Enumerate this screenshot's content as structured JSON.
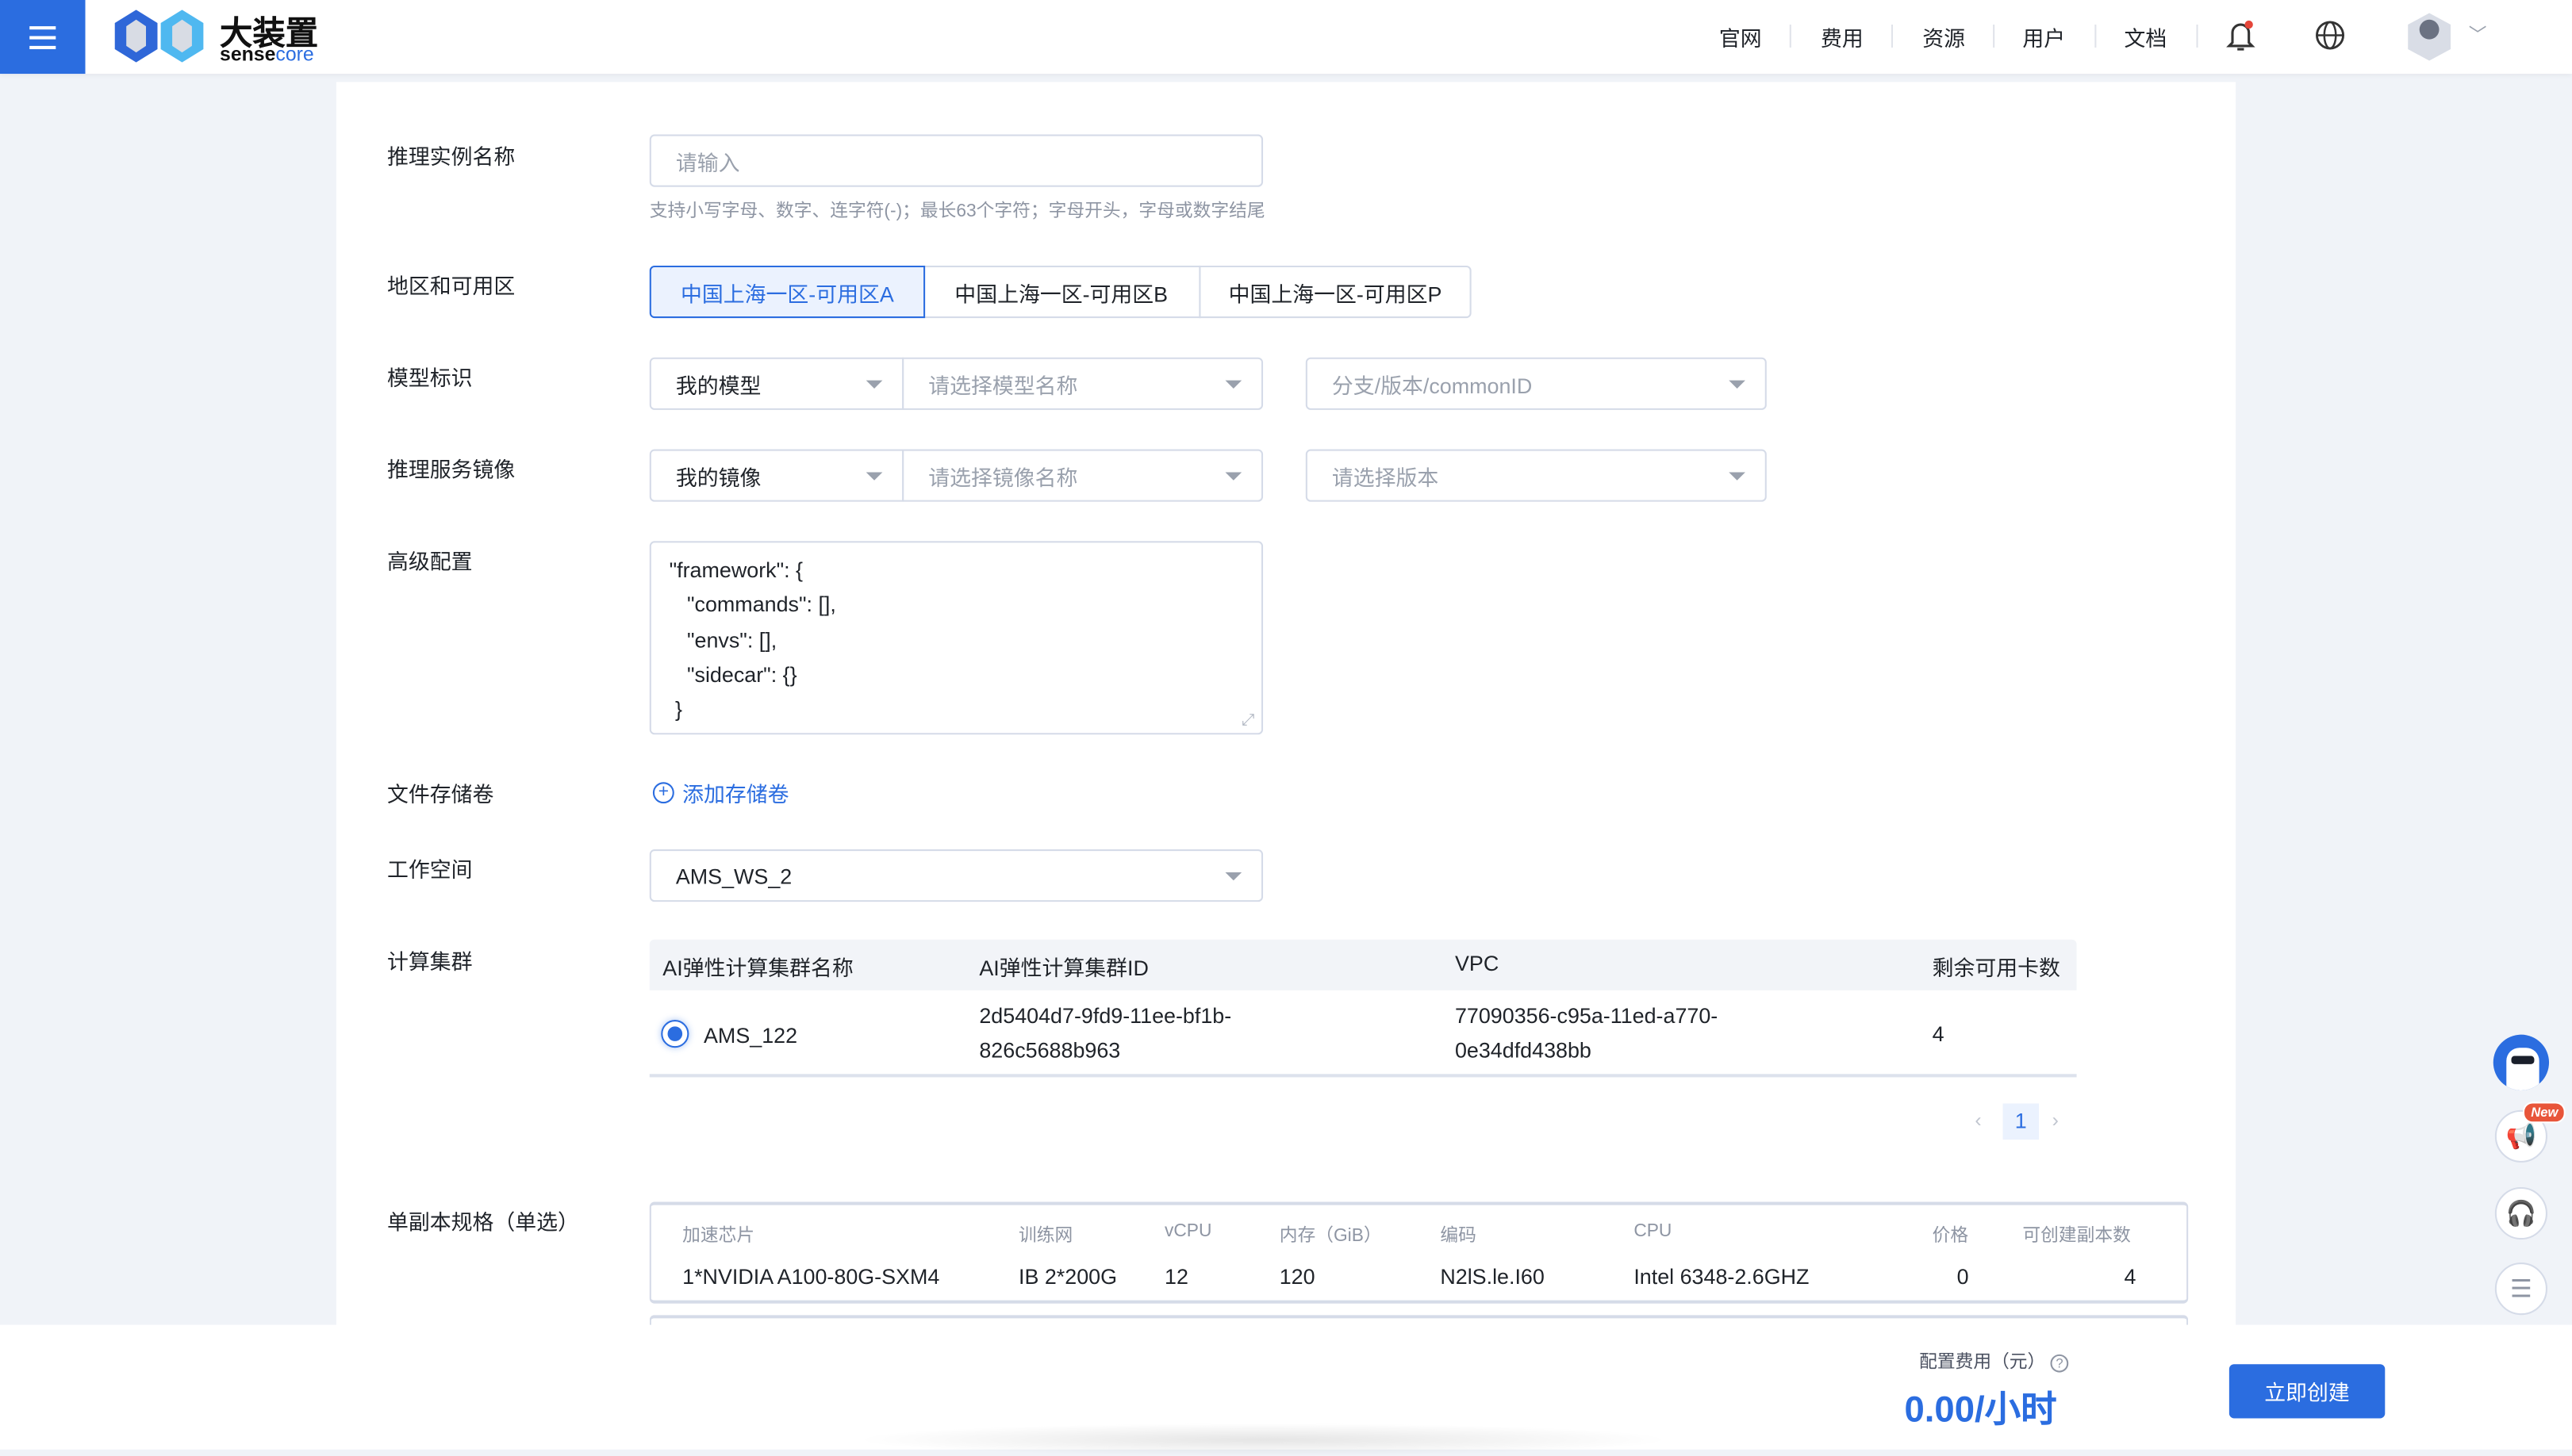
{
  "header": {
    "logo_cn": "大装置",
    "logo_en_1": "sense",
    "logo_en_2": "core",
    "nav": [
      "官网",
      "费用",
      "资源",
      "用户",
      "文档"
    ]
  },
  "form": {
    "name": {
      "label": "推理实例名称",
      "placeholder": "请输入",
      "hint": "支持小写字母、数字、连字符(-)；最长63个字符；字母开头，字母或数字结尾"
    },
    "zone": {
      "label": "地区和可用区",
      "options": [
        "中国上海一区-可用区A",
        "中国上海一区-可用区B",
        "中国上海一区-可用区P"
      ],
      "selected": "中国上海一区-可用区A"
    },
    "model": {
      "label": "模型标识",
      "type": "我的模型",
      "name_placeholder": "请选择模型名称",
      "version_placeholder": "分支/版本/commonID"
    },
    "image": {
      "label": "推理服务镜像",
      "type": "我的镜像",
      "name_placeholder": "请选择镜像名称",
      "version_placeholder": "请选择版本"
    },
    "advanced": {
      "label": "高级配置",
      "value": "\"framework\": {\n   \"commands\": [],\n   \"envs\": [],\n   \"sidecar\": {}\n }"
    },
    "storage": {
      "label": "文件存储卷",
      "add_label": "添加存储卷"
    },
    "workspace": {
      "label": "工作空间",
      "value": "AMS_WS_2"
    },
    "cluster": {
      "label": "计算集群",
      "columns": [
        "AI弹性计算集群名称",
        "AI弹性计算集群ID",
        "VPC",
        "剩余可用卡数"
      ],
      "rows": [
        {
          "name": "AMS_122",
          "id_1": "2d5404d7-9fd9-11ee-bf1b-",
          "id_2": "826c5688b963",
          "vpc_1": "77090356-c95a-11ed-a770-",
          "vpc_2": "0e34dfd438bb",
          "cards": "4",
          "selected": true
        }
      ],
      "page": "1"
    },
    "spec": {
      "label": "单副本规格（单选）",
      "columns": [
        "加速芯片",
        "训练网",
        "vCPU",
        "内存（GiB）",
        "编码",
        "CPU",
        "价格",
        "可创建副本数"
      ],
      "row": [
        "1*NVIDIA A100-80G-SXM4",
        "IB 2*200G",
        "12",
        "120",
        "N2lS.le.I60",
        "Intel 6348-2.6GHZ",
        "0",
        "4"
      ]
    }
  },
  "footer": {
    "cost_label": "配置费用（元）",
    "cost_value": "0.00/小时",
    "create_label": "立即创建"
  },
  "float": {
    "new_badge": "New"
  },
  "colors": {
    "primary": "#2b6de0",
    "background": "#f0f3f8"
  }
}
